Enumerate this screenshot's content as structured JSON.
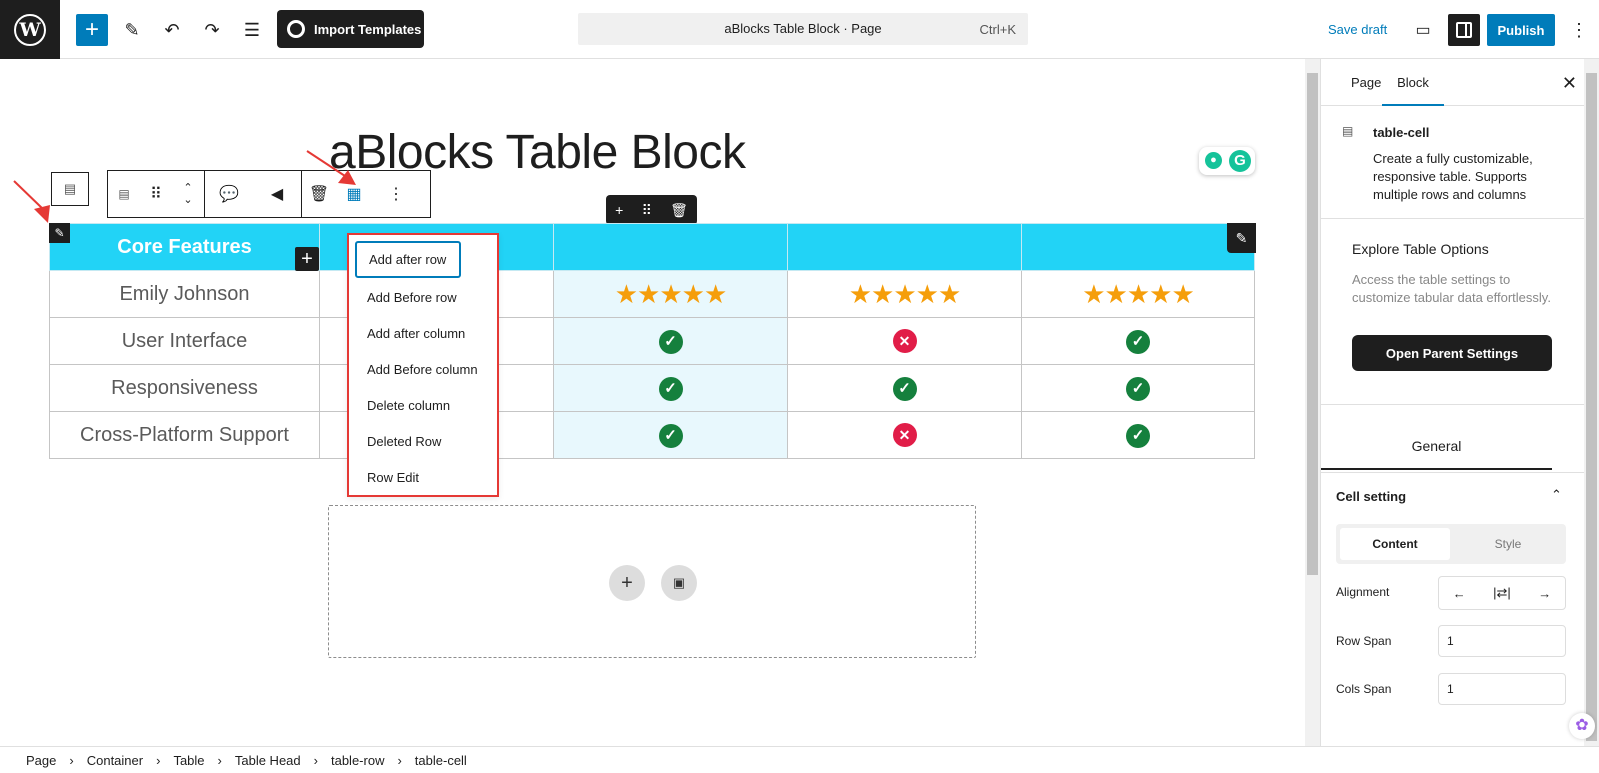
{
  "header": {
    "import_label": "Import Templates",
    "doc_title": "aBlocks Table Block · Page",
    "shortcut": "Ctrl+K",
    "save_draft": "Save draft",
    "publish": "Publish"
  },
  "editor": {
    "page_title": "aBlocks Table Block",
    "table": {
      "head": [
        "Core Features",
        "",
        "",
        "",
        ""
      ],
      "rows": [
        {
          "label": "Emily Johnson",
          "cells": [
            "stars",
            "stars",
            "stars"
          ]
        },
        {
          "label": "User Interface",
          "cells": [
            "check",
            "cross",
            "check"
          ]
        },
        {
          "label": "Responsiveness",
          "cells": [
            "check",
            "check",
            "check"
          ]
        },
        {
          "label": "Cross-Platform Support",
          "cells": [
            "check",
            "cross",
            "check"
          ]
        }
      ],
      "rating_stars": 5
    },
    "context_menu": [
      "Add after row",
      "Add Before row",
      "Add after column",
      "Add Before column",
      "Delete column",
      "Deleted Row",
      "Row Edit"
    ]
  },
  "sidebar": {
    "tabs": [
      "Page",
      "Block"
    ],
    "block_name": "table-cell",
    "block_desc": "Create a fully customizable, responsive table. Supports multiple rows and columns",
    "explore_title": "Explore Table Options",
    "explore_desc": "Access the table settings to customize tabular data effortlessly.",
    "open_parent": "Open Parent Settings",
    "general_tab": "General",
    "cell_setting": "Cell setting",
    "seg_content": "Content",
    "seg_style": "Style",
    "alignment_label": "Alignment",
    "row_span_label": "Row Span",
    "row_span_value": "1",
    "cols_span_label": "Cols Span",
    "cols_span_value": "1"
  },
  "breadcrumb": [
    "Page",
    "Container",
    "Table",
    "Table Head",
    "table-row",
    "table-cell"
  ],
  "colors": {
    "accent": "#007cba",
    "table_head": "#22d3f6",
    "check": "#15803d",
    "cross": "#e11d48",
    "star": "#f59e0b",
    "menu_border": "#e53935"
  }
}
